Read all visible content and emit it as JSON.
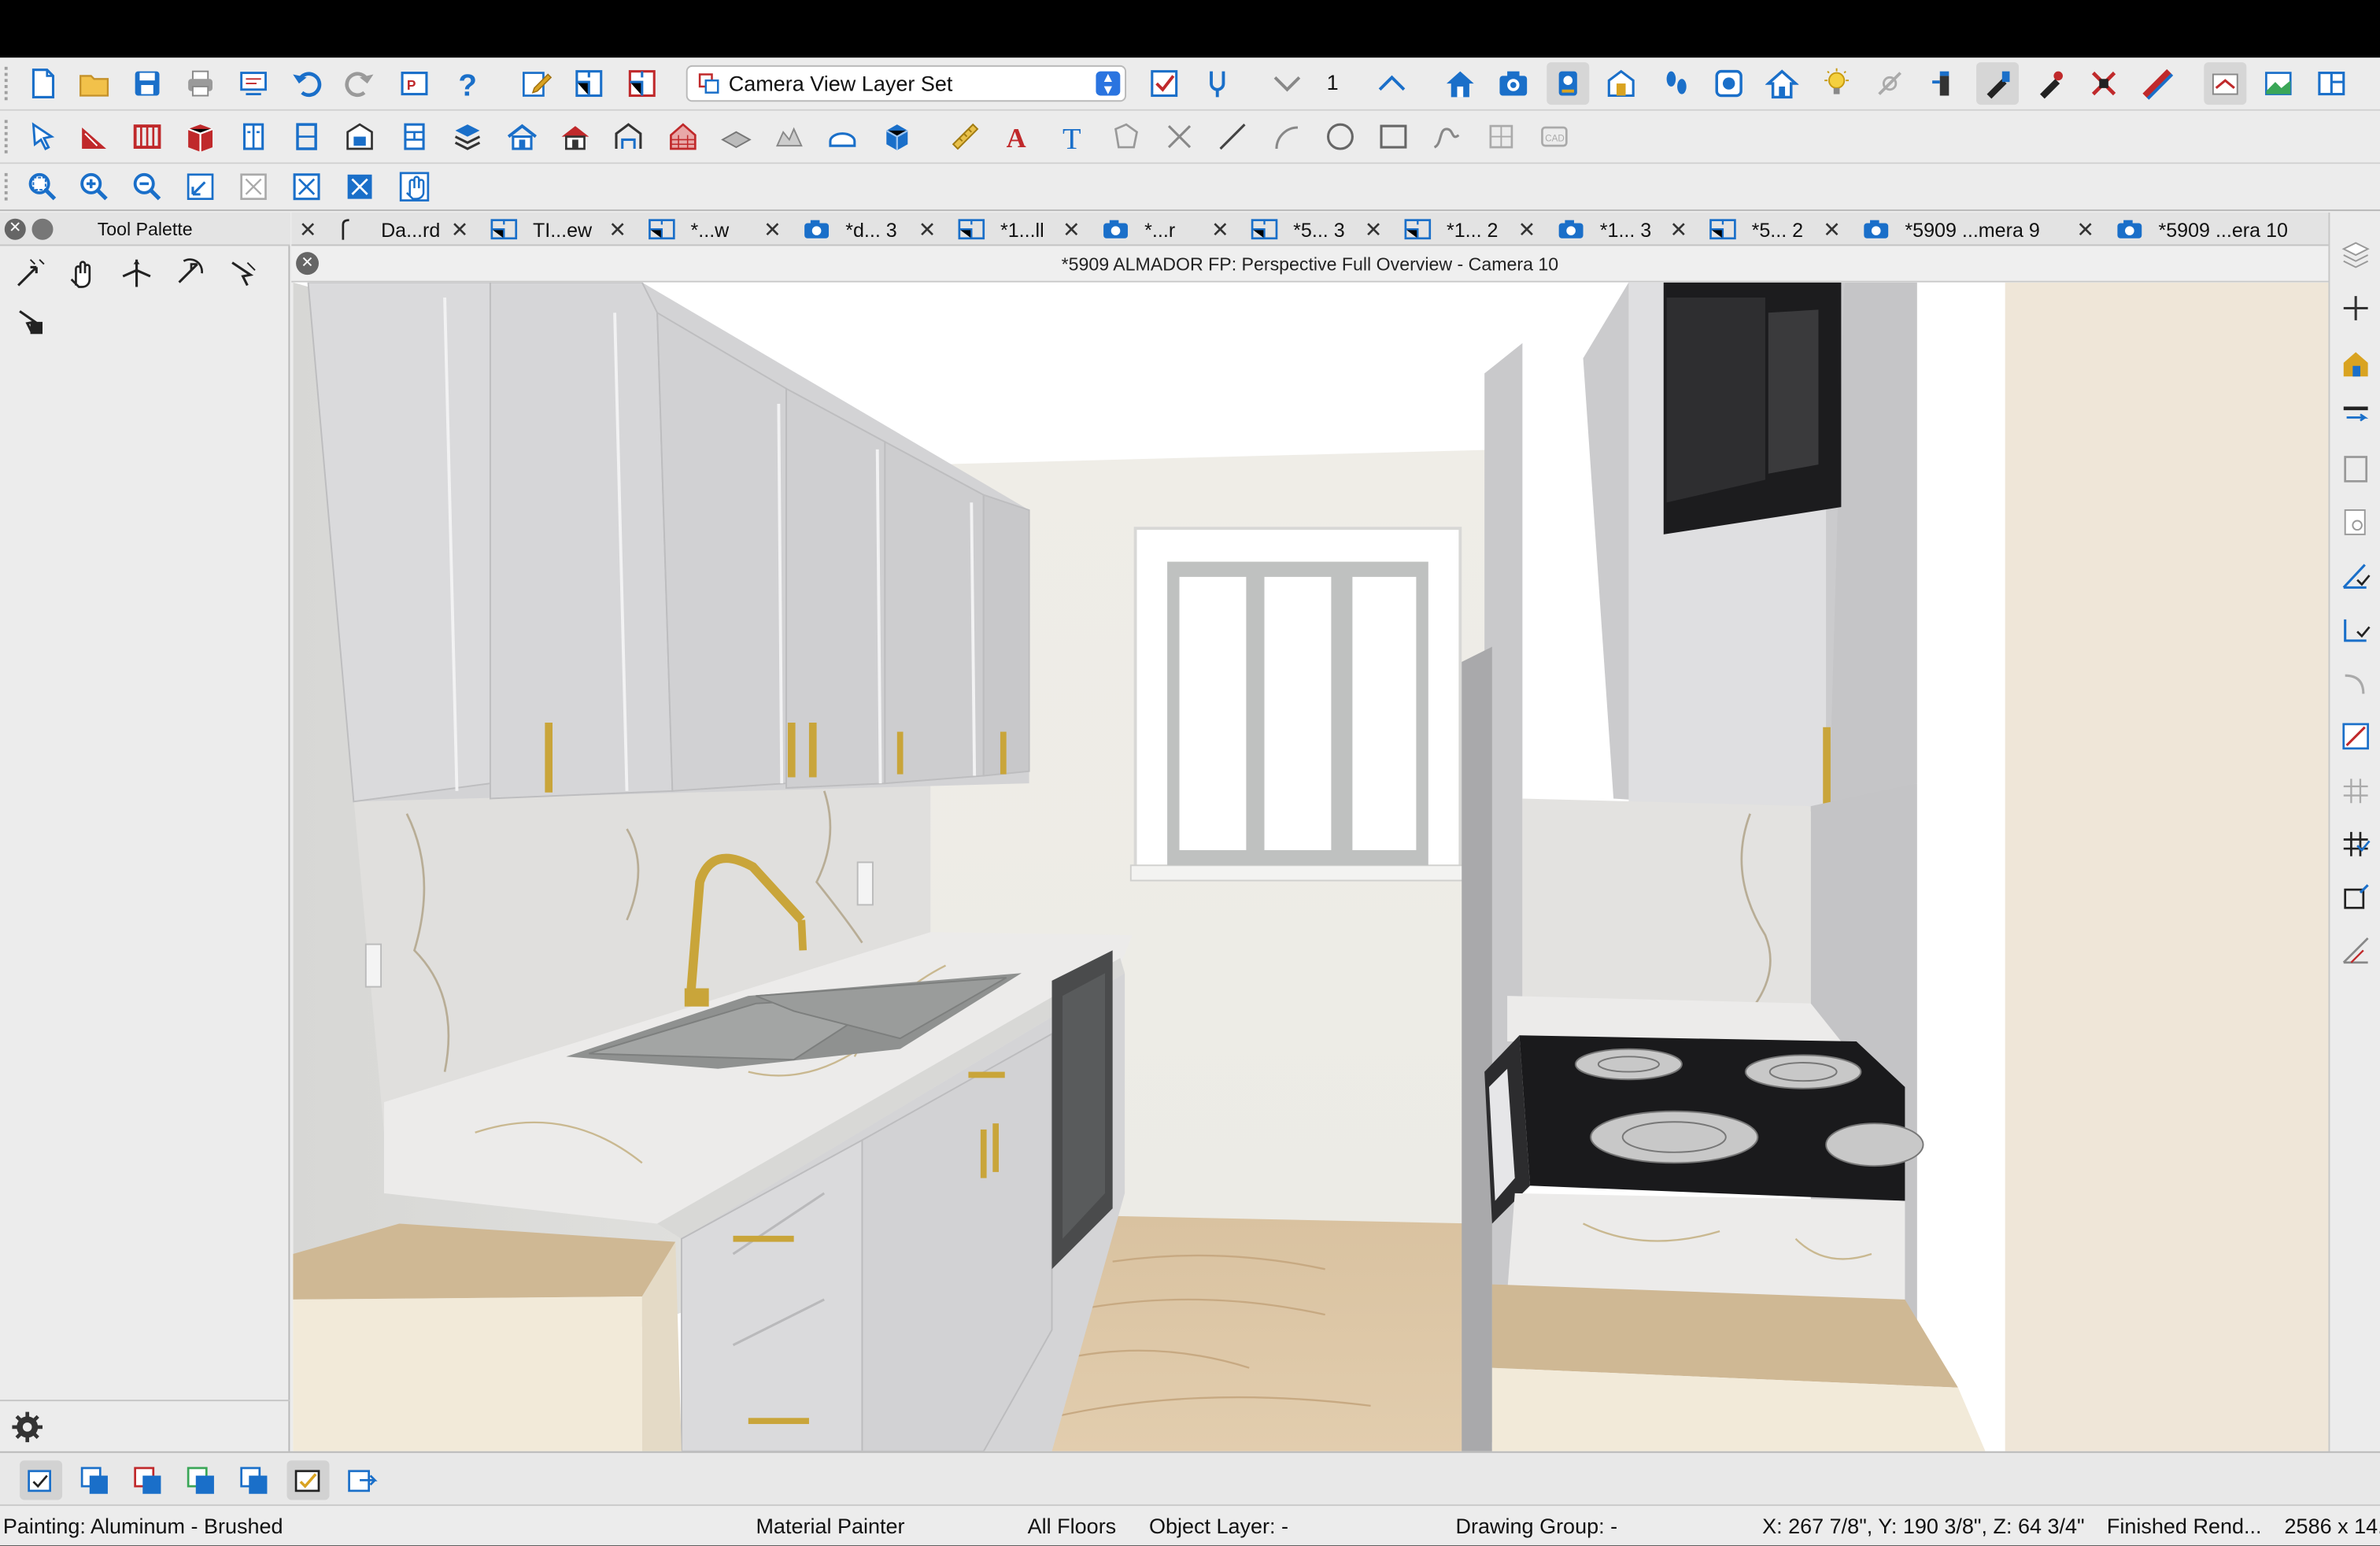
{
  "toolbar1": {
    "layer_set": "Camera View Layer Set",
    "floor_number": "1"
  },
  "palette": {
    "title": "Tool Palette"
  },
  "tabs": [
    {
      "label": "Da...rd",
      "icon": "elevation-icon"
    },
    {
      "label": "TI...ew",
      "icon": "plan-icon"
    },
    {
      "label": "*...w",
      "icon": "plan-icon"
    },
    {
      "label": "*d... 3",
      "icon": "camera-icon"
    },
    {
      "label": "*1...ll",
      "icon": "plan-icon"
    },
    {
      "label": "*...r",
      "icon": "camera-icon"
    },
    {
      "label": "*5... 3",
      "icon": "plan-icon"
    },
    {
      "label": "*1... 2",
      "icon": "plan-icon"
    },
    {
      "label": "*1... 3",
      "icon": "camera-icon"
    },
    {
      "label": "*5... 2",
      "icon": "plan-icon"
    },
    {
      "label": "*5909 ...mera 9",
      "icon": "camera-icon"
    },
    {
      "label": "*5909 ...era 10",
      "icon": "camera-icon"
    }
  ],
  "view": {
    "title": "*5909 ALMADOR FP: Perspective Full Overview - Camera 10"
  },
  "status": {
    "painting": "Painting: Aluminum - Brushed",
    "tool": "Material Painter",
    "floors": "All Floors",
    "object_layer": "Object Layer: -",
    "drawing_group": "Drawing Group: -",
    "coords": "X: 267 7/8\", Y: 190 3/8\", Z: 64 3/4\"",
    "render": "Finished Rend...",
    "size": "2586 x 14..."
  },
  "colors": {
    "accent": "#1a6fc9",
    "icon_red": "#c0292b",
    "icon_gold": "#d9a321",
    "cabinet": "#d3d3d5",
    "counter": "#ecebea",
    "floor_wood": "#dcc4a2",
    "hardware_brass": "#c9a53a"
  }
}
